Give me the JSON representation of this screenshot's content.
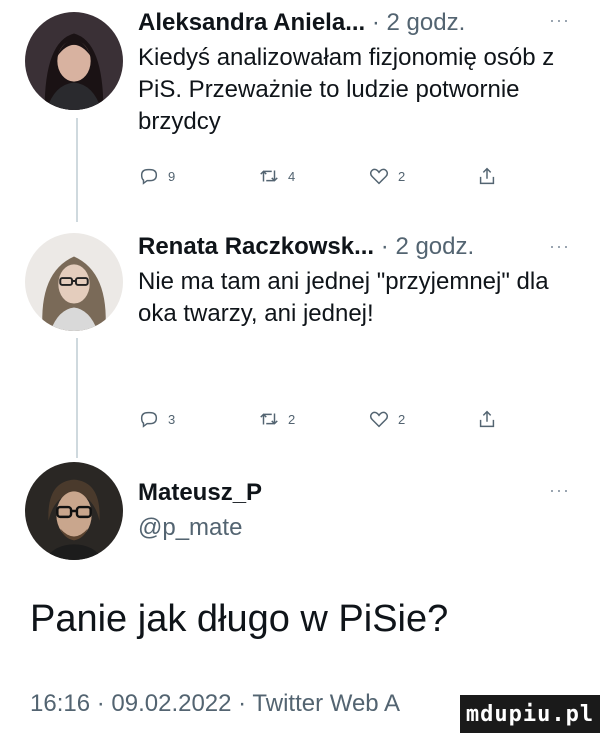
{
  "tweets": [
    {
      "author": "Aleksandra Aniela...",
      "time": "· 2 godz.",
      "more": "···",
      "text": "Kiedyś analizowałam fizjonomię osób z PiS. Przeważnie to ludzie potwornie brzydcy",
      "replies": "9",
      "retweets": "4",
      "likes": "2"
    },
    {
      "author": "Renata Raczkowsk...",
      "time": "· 2 godz.",
      "more": "···",
      "text": "Nie ma tam ani jednej \"przyjemnej\" dla oka twarzy, ani jednej!",
      "replies": "3",
      "retweets": "2",
      "likes": "2"
    }
  ],
  "main": {
    "author": "Mateusz_P",
    "handle": "@p_mate",
    "more": "···",
    "text": "Panie jak długo w PiSie?",
    "footer": "16:16 · 09.02.2022 · Twitter Web A"
  },
  "watermark": "mdupiu.pl",
  "colors": {
    "secondary": "#536471",
    "line": "#cfd9de",
    "text": "#0f1419"
  },
  "icons": [
    "reply-icon",
    "retweet-icon",
    "like-icon",
    "share-icon"
  ]
}
